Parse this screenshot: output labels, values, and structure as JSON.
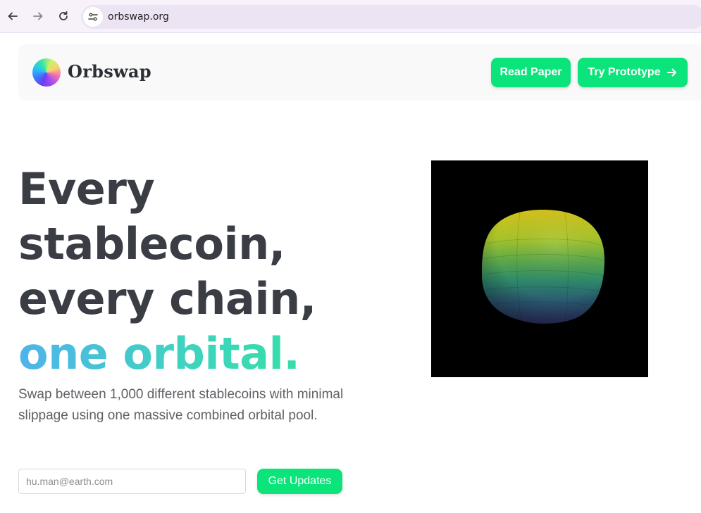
{
  "browser": {
    "url": "orbswap.org",
    "icons": {
      "back": "arrow-left-icon",
      "forward": "arrow-right-icon",
      "reload": "reload-icon",
      "site_info": "tune-icon"
    }
  },
  "header": {
    "brand": "Orbswap",
    "read_paper_label": "Read Paper",
    "try_prototype_label": "Try Prototype",
    "accent_color": "#0ae47a"
  },
  "hero": {
    "title_lines": [
      "Every",
      "stablecoin,",
      "every chain,"
    ],
    "title_accent": "one orbital.",
    "subtitle": "Swap between 1,000 different stablecoins with minimal slippage using one massive combined orbital pool.",
    "email_placeholder": "hu.man@earth.com",
    "cta_label": "Get Updates",
    "accent_gradient": [
      "#4fb3ea",
      "#3fd3c0",
      "#2ee597"
    ]
  }
}
